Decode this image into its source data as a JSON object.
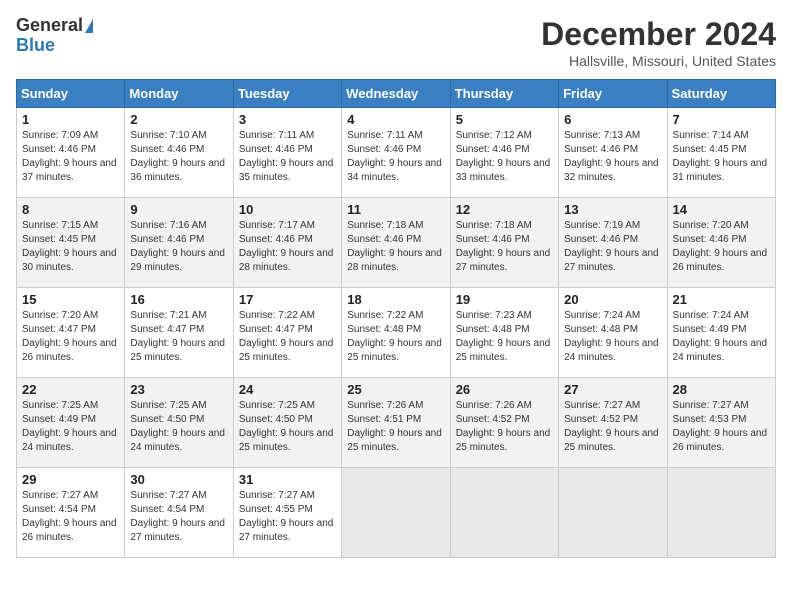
{
  "logo": {
    "general": "General",
    "blue": "Blue"
  },
  "title": "December 2024",
  "subtitle": "Hallsville, Missouri, United States",
  "days_of_week": [
    "Sunday",
    "Monday",
    "Tuesday",
    "Wednesday",
    "Thursday",
    "Friday",
    "Saturday"
  ],
  "weeks": [
    [
      {
        "day": "1",
        "sunrise": "Sunrise: 7:09 AM",
        "sunset": "Sunset: 4:46 PM",
        "daylight": "Daylight: 9 hours and 37 minutes."
      },
      {
        "day": "2",
        "sunrise": "Sunrise: 7:10 AM",
        "sunset": "Sunset: 4:46 PM",
        "daylight": "Daylight: 9 hours and 36 minutes."
      },
      {
        "day": "3",
        "sunrise": "Sunrise: 7:11 AM",
        "sunset": "Sunset: 4:46 PM",
        "daylight": "Daylight: 9 hours and 35 minutes."
      },
      {
        "day": "4",
        "sunrise": "Sunrise: 7:11 AM",
        "sunset": "Sunset: 4:46 PM",
        "daylight": "Daylight: 9 hours and 34 minutes."
      },
      {
        "day": "5",
        "sunrise": "Sunrise: 7:12 AM",
        "sunset": "Sunset: 4:46 PM",
        "daylight": "Daylight: 9 hours and 33 minutes."
      },
      {
        "day": "6",
        "sunrise": "Sunrise: 7:13 AM",
        "sunset": "Sunset: 4:46 PM",
        "daylight": "Daylight: 9 hours and 32 minutes."
      },
      {
        "day": "7",
        "sunrise": "Sunrise: 7:14 AM",
        "sunset": "Sunset: 4:45 PM",
        "daylight": "Daylight: 9 hours and 31 minutes."
      }
    ],
    [
      {
        "day": "8",
        "sunrise": "Sunrise: 7:15 AM",
        "sunset": "Sunset: 4:45 PM",
        "daylight": "Daylight: 9 hours and 30 minutes."
      },
      {
        "day": "9",
        "sunrise": "Sunrise: 7:16 AM",
        "sunset": "Sunset: 4:46 PM",
        "daylight": "Daylight: 9 hours and 29 minutes."
      },
      {
        "day": "10",
        "sunrise": "Sunrise: 7:17 AM",
        "sunset": "Sunset: 4:46 PM",
        "daylight": "Daylight: 9 hours and 28 minutes."
      },
      {
        "day": "11",
        "sunrise": "Sunrise: 7:18 AM",
        "sunset": "Sunset: 4:46 PM",
        "daylight": "Daylight: 9 hours and 28 minutes."
      },
      {
        "day": "12",
        "sunrise": "Sunrise: 7:18 AM",
        "sunset": "Sunset: 4:46 PM",
        "daylight": "Daylight: 9 hours and 27 minutes."
      },
      {
        "day": "13",
        "sunrise": "Sunrise: 7:19 AM",
        "sunset": "Sunset: 4:46 PM",
        "daylight": "Daylight: 9 hours and 27 minutes."
      },
      {
        "day": "14",
        "sunrise": "Sunrise: 7:20 AM",
        "sunset": "Sunset: 4:46 PM",
        "daylight": "Daylight: 9 hours and 26 minutes."
      }
    ],
    [
      {
        "day": "15",
        "sunrise": "Sunrise: 7:20 AM",
        "sunset": "Sunset: 4:47 PM",
        "daylight": "Daylight: 9 hours and 26 minutes."
      },
      {
        "day": "16",
        "sunrise": "Sunrise: 7:21 AM",
        "sunset": "Sunset: 4:47 PM",
        "daylight": "Daylight: 9 hours and 25 minutes."
      },
      {
        "day": "17",
        "sunrise": "Sunrise: 7:22 AM",
        "sunset": "Sunset: 4:47 PM",
        "daylight": "Daylight: 9 hours and 25 minutes."
      },
      {
        "day": "18",
        "sunrise": "Sunrise: 7:22 AM",
        "sunset": "Sunset: 4:48 PM",
        "daylight": "Daylight: 9 hours and 25 minutes."
      },
      {
        "day": "19",
        "sunrise": "Sunrise: 7:23 AM",
        "sunset": "Sunset: 4:48 PM",
        "daylight": "Daylight: 9 hours and 25 minutes."
      },
      {
        "day": "20",
        "sunrise": "Sunrise: 7:24 AM",
        "sunset": "Sunset: 4:48 PM",
        "daylight": "Daylight: 9 hours and 24 minutes."
      },
      {
        "day": "21",
        "sunrise": "Sunrise: 7:24 AM",
        "sunset": "Sunset: 4:49 PM",
        "daylight": "Daylight: 9 hours and 24 minutes."
      }
    ],
    [
      {
        "day": "22",
        "sunrise": "Sunrise: 7:25 AM",
        "sunset": "Sunset: 4:49 PM",
        "daylight": "Daylight: 9 hours and 24 minutes."
      },
      {
        "day": "23",
        "sunrise": "Sunrise: 7:25 AM",
        "sunset": "Sunset: 4:50 PM",
        "daylight": "Daylight: 9 hours and 24 minutes."
      },
      {
        "day": "24",
        "sunrise": "Sunrise: 7:25 AM",
        "sunset": "Sunset: 4:50 PM",
        "daylight": "Daylight: 9 hours and 25 minutes."
      },
      {
        "day": "25",
        "sunrise": "Sunrise: 7:26 AM",
        "sunset": "Sunset: 4:51 PM",
        "daylight": "Daylight: 9 hours and 25 minutes."
      },
      {
        "day": "26",
        "sunrise": "Sunrise: 7:26 AM",
        "sunset": "Sunset: 4:52 PM",
        "daylight": "Daylight: 9 hours and 25 minutes."
      },
      {
        "day": "27",
        "sunrise": "Sunrise: 7:27 AM",
        "sunset": "Sunset: 4:52 PM",
        "daylight": "Daylight: 9 hours and 25 minutes."
      },
      {
        "day": "28",
        "sunrise": "Sunrise: 7:27 AM",
        "sunset": "Sunset: 4:53 PM",
        "daylight": "Daylight: 9 hours and 26 minutes."
      }
    ],
    [
      {
        "day": "29",
        "sunrise": "Sunrise: 7:27 AM",
        "sunset": "Sunset: 4:54 PM",
        "daylight": "Daylight: 9 hours and 26 minutes."
      },
      {
        "day": "30",
        "sunrise": "Sunrise: 7:27 AM",
        "sunset": "Sunset: 4:54 PM",
        "daylight": "Daylight: 9 hours and 27 minutes."
      },
      {
        "day": "31",
        "sunrise": "Sunrise: 7:27 AM",
        "sunset": "Sunset: 4:55 PM",
        "daylight": "Daylight: 9 hours and 27 minutes."
      },
      null,
      null,
      null,
      null
    ]
  ]
}
